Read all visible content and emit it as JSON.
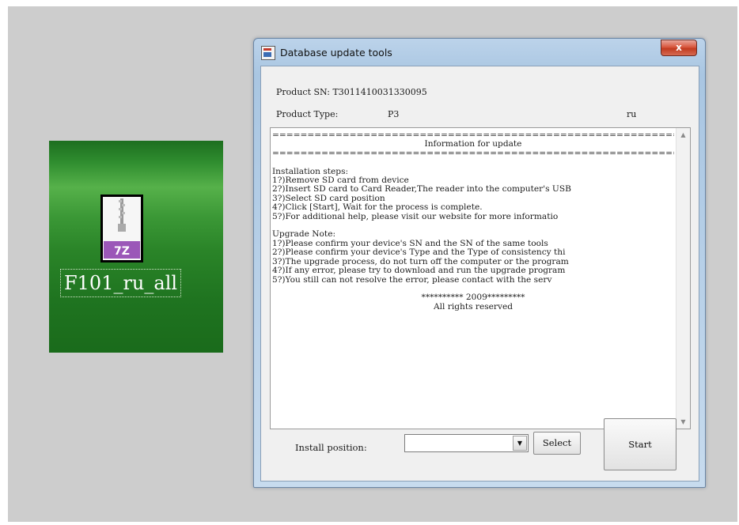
{
  "desktop": {
    "file_name": "F101_ru_all",
    "file_badge": "7Z",
    "icons": {
      "file": "7z-archive-icon"
    }
  },
  "window": {
    "title": "Database update tools",
    "close_label": "x",
    "product_sn_label": "Product SN:",
    "product_sn_value": "T3011410031330095",
    "product_type_label": "Product Type:",
    "product_type_value": "P3",
    "region_value": "ru",
    "info": {
      "rule": "==========================================================",
      "heading": "Information for update",
      "install_title": "Installation steps:",
      "install_steps": [
        "1?)Remove SD card from device",
        "2?)Insert SD card to Card Reader,The reader into the computer's USB",
        "3?)Select SD card position",
        "4?)Click [Start], Wait for the process is complete.",
        "5?)For additional help, please visit our website for more informatio"
      ],
      "upgrade_title": "Upgrade Note:",
      "upgrade_notes": [
        "1?)Please confirm your device's SN and the SN of the same tools",
        "2?)Please confirm your device's Type and the Type of consistency thi",
        "3?)The upgrade process, do not turn off the computer or the program",
        "4?)If any error, please try to download and run the upgrade program",
        "5?)You still can not resolve the error, please contact with the serv"
      ],
      "copyright_line1": "********** 2009*********",
      "copyright_line2": "All rights reserved"
    },
    "install_position_label": "Install position:",
    "install_position_value": "",
    "select_label": "Select",
    "start_label": "Start"
  }
}
